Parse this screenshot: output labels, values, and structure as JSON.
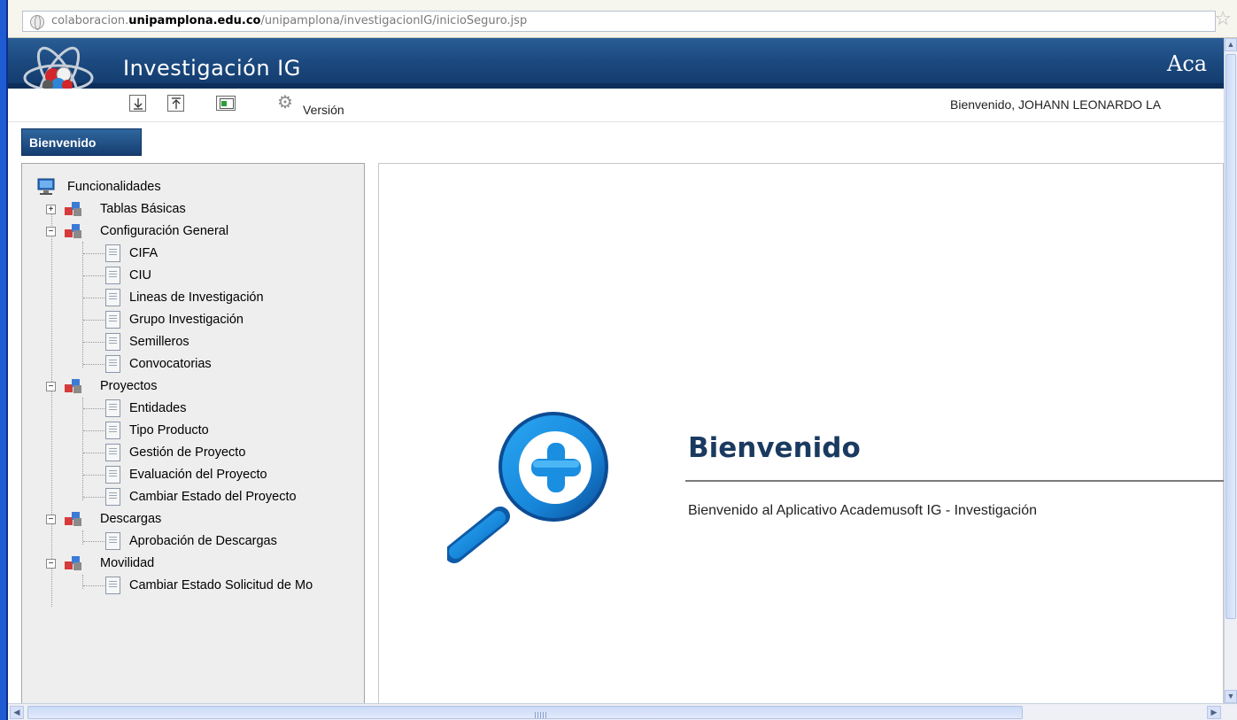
{
  "browser": {
    "url_prefix": "colaboracion.",
    "url_domain": "unipamplona.edu.co",
    "url_path": "/unipamplona/investigacionIG/inicioSeguro.jsp"
  },
  "header": {
    "title": "Investigación IG",
    "right_text": "Aca"
  },
  "toolbar": {
    "version_label": "Versión",
    "welcome_user": "Bienvenido, JOHANN LEONARDO LA"
  },
  "tab": {
    "label": "Bienvenido"
  },
  "tree": {
    "root_label": "Funcionalidades",
    "groups": [
      {
        "label": "Tablas Básicas",
        "expanded": false,
        "items": []
      },
      {
        "label": "Configuración General",
        "expanded": true,
        "items": [
          "CIFA",
          "CIU",
          "Lineas de Investigación",
          "Grupo Investigación",
          "Semilleros",
          "Convocatorias"
        ]
      },
      {
        "label": "Proyectos",
        "expanded": true,
        "items": [
          "Entidades",
          "Tipo Producto",
          "Gestión de Proyecto",
          "Evaluación del Proyecto",
          "Cambiar Estado del Proyecto"
        ]
      },
      {
        "label": "Descargas",
        "expanded": true,
        "items": [
          "Aprobación de Descargas"
        ]
      },
      {
        "label": "Movilidad",
        "expanded": true,
        "items": [
          "Cambiar Estado Solicitud de Mo"
        ]
      }
    ]
  },
  "main": {
    "heading": "Bienvenido",
    "message": "Bienvenido al Aplicativo Academusoft IG - Investigación"
  },
  "colors": {
    "header_blue": "#1c4a80",
    "logo_blue": "#1b8fe0",
    "heading_color": "#1a3a60"
  }
}
